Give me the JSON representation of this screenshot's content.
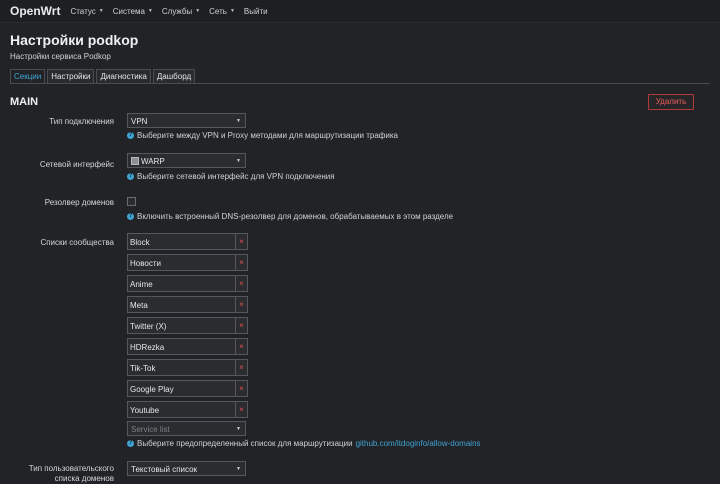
{
  "navbar": {
    "brand": "OpenWrt",
    "items": [
      {
        "label": "Статус",
        "caret": true
      },
      {
        "label": "Система",
        "caret": true
      },
      {
        "label": "Службы",
        "caret": true
      },
      {
        "label": "Сеть",
        "caret": true
      },
      {
        "label": "Выйти",
        "caret": false
      }
    ]
  },
  "page": {
    "title": "Настройки podkop",
    "subtitle": "Настройки сервиса Podkop"
  },
  "tabs": [
    {
      "label": "Секции",
      "active": true
    },
    {
      "label": "Настройки",
      "active": false
    },
    {
      "label": "Диагностика",
      "active": false
    },
    {
      "label": "Дашборд",
      "active": false
    }
  ],
  "section": {
    "title": "MAIN",
    "delete_label": "Удалить"
  },
  "fields": {
    "connection_type": {
      "label": "Тип подключения",
      "value": "VPN",
      "hint": "Выберите между VPN и Proxy методами для маршрутизации трафика"
    },
    "network_interface": {
      "label": "Сетевой интерфейс",
      "value": "WARP",
      "hint": "Выберите сетевой интерфейс для VPN подключения"
    },
    "domain_resolver": {
      "label": "Резолвер доменов",
      "checked": false,
      "hint": "Включить встроенный DNS-резолвер для доменов, обрабатываемых в этом разделе"
    },
    "community_lists": {
      "label": "Списки сообщества",
      "items": [
        "Block",
        "Новости",
        "Anime",
        "Meta",
        "Twitter (X)",
        "HDRezka",
        "Tik-Tok",
        "Google Play",
        "Youtube"
      ],
      "remove_glyph": "×",
      "placeholder": "Service list",
      "hint": "Выберите предопределенный список для маршрутизации",
      "hint_link": "github.com/itdoginfo/allow-domains"
    },
    "custom_domain_type": {
      "label_line1": "Тип пользовательского",
      "label_line2": "списка доменов",
      "value": "Текстовый список"
    }
  },
  "colors": {
    "background": "#222326",
    "accent": "#3fa3d4",
    "danger": "#e85252"
  }
}
